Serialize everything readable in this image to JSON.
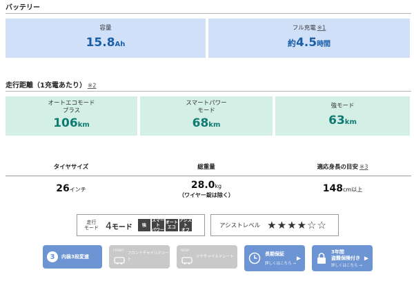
{
  "battery": {
    "title": "バッテリー",
    "capacity": {
      "label": "容量",
      "value": "15.8",
      "unit": "Ah"
    },
    "full_charge": {
      "label": "フル充電",
      "note": "※1",
      "prefix": "約",
      "value": "4.5",
      "unit": "時間"
    }
  },
  "range": {
    "title": "走行距離（1充電あたり）",
    "note": "※2",
    "items": [
      {
        "label_line1": "オートエコモード",
        "label_line2": "プラス",
        "value": "106",
        "unit": "km"
      },
      {
        "label_line1": "スマートパワー",
        "label_line2": "モード",
        "value": "68",
        "unit": "km"
      },
      {
        "label_line1": "強モード",
        "label_line2": "",
        "value": "63",
        "unit": "km"
      }
    ]
  },
  "specs": {
    "tire": {
      "header": "タイヤサイズ",
      "value": "26",
      "unit": "インチ"
    },
    "weight": {
      "header": "総重量",
      "value": "28.0",
      "unit": "kg",
      "sub": "（ワイヤー錠は除く）"
    },
    "height": {
      "header": "適応身長の目安",
      "note": "※3",
      "value": "148",
      "unit": "cm",
      "suffix": "以上"
    }
  },
  "modes": {
    "label_line1": "走行",
    "label_line2": "モード",
    "count_num": "4",
    "count_text": "モード",
    "chips": [
      {
        "line1": "強",
        "line2": ""
      },
      {
        "line1": "スマート",
        "line2": "パワー"
      },
      {
        "line1": "オート",
        "line2": "エコ"
      },
      {
        "line1": "アシスト",
        "line2": "オフ"
      }
    ]
  },
  "assist": {
    "label": "アシストレベル",
    "level": 4,
    "max": 6,
    "stars": [
      "★",
      "★",
      "★",
      "★",
      "☆",
      "☆"
    ]
  },
  "badges": [
    {
      "icon_text": "3",
      "title": "内装3段変速",
      "sub": "",
      "active": true
    },
    {
      "icon_text": "",
      "title": "フロントチャイルドシート",
      "sub": "FRONT",
      "active": false
    },
    {
      "icon_text": "",
      "title": "リヤチャイルドシート",
      "sub": "REAR",
      "active": false
    },
    {
      "icon_text": "",
      "title": "長期保証",
      "sub": "詳しくはこちら →",
      "active": true
    },
    {
      "icon_text": "",
      "title": "3年間",
      "title2": "盗難保険付き",
      "sub": "詳しくはこちら →",
      "active": true
    }
  ],
  "colors": {
    "battery_box_bg": "#cfe0f8",
    "battery_value": "#1a5ea8",
    "range_box_bg": "#d3efe6",
    "range_value": "#0f7a72",
    "badge_active": "#6d95d4",
    "badge_inactive": "#c9c9c9"
  }
}
